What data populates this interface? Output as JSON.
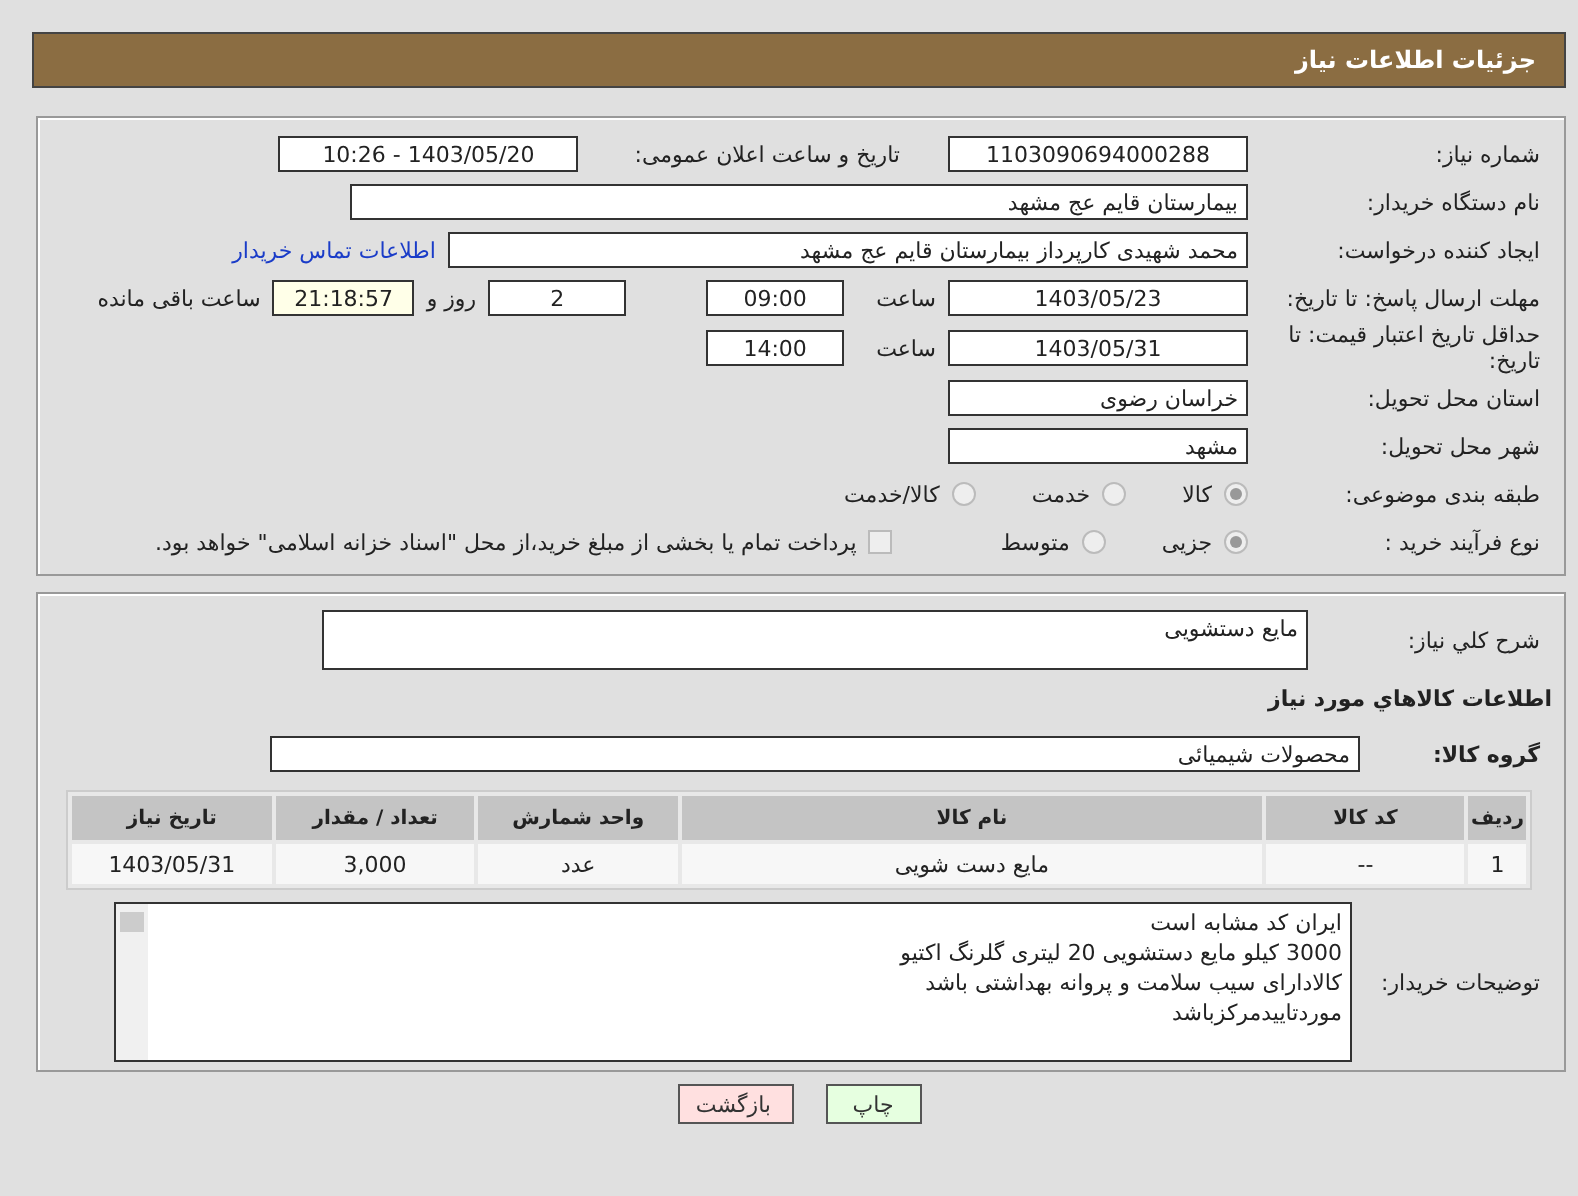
{
  "header": {
    "title": "جزئیات اطلاعات نیاز"
  },
  "need_number": {
    "label": "شماره نیاز:",
    "value": "1103090694000288"
  },
  "announce_date": {
    "label": "تاریخ و ساعت اعلان عمومی:",
    "value": "1403/05/20 - 10:26"
  },
  "buyer_org": {
    "label": "نام دستگاه خریدار:",
    "value": "بیمارستان قایم  عج  مشهد"
  },
  "requester": {
    "label": "ایجاد کننده درخواست:",
    "value": "محمد شهیدی کارپرداز بیمارستان قایم  عج  مشهد",
    "link": "اطلاعات تماس خریدار"
  },
  "reply_deadline": {
    "label": "مهلت ارسال پاسخ: تا تاریخ:",
    "date": "1403/05/23",
    "time_label": "ساعت",
    "time": "09:00",
    "days": "2",
    "days_label": "روز و",
    "remaining": "21:18:57",
    "remaining_label": "ساعت باقی مانده"
  },
  "price_validity": {
    "label": "حداقل تاریخ اعتبار قیمت: تا تاریخ:",
    "date": "1403/05/31",
    "time_label": "ساعت",
    "time": "14:00"
  },
  "province": {
    "label": "استان محل تحویل:",
    "value": "خراسان رضوی"
  },
  "city": {
    "label": "شهر محل تحویل:",
    "value": "مشهد"
  },
  "category": {
    "label": "طبقه بندی موضوعی:",
    "options": [
      {
        "label": "کالا",
        "selected": true
      },
      {
        "label": "خدمت",
        "selected": false
      },
      {
        "label": "کالا/خدمت",
        "selected": false
      }
    ]
  },
  "purchase_type": {
    "label": "نوع فرآیند خرید :",
    "options": [
      {
        "label": "جزیی",
        "selected": true
      },
      {
        "label": "متوسط",
        "selected": false
      }
    ],
    "treasury": {
      "label": "پرداخت تمام یا بخشی از مبلغ خرید،از محل \"اسناد خزانه اسلامی\" خواهد بود.",
      "checked": false
    }
  },
  "description": {
    "label": "شرح کلي نياز:",
    "value": "مایع دستشویی"
  },
  "items_heading": "اطلاعات كالاهاي مورد نياز",
  "goods_group": {
    "label": "گروه کالا:",
    "value": "محصولات شیمیائی"
  },
  "table": {
    "columns": [
      "ردیف",
      "کد کالا",
      "نام کالا",
      "واحد شمارش",
      "تعداد / مقدار",
      "تاریخ نیاز"
    ],
    "rows": [
      [
        "1",
        "--",
        "مایع دست شویی",
        "عدد",
        "3,000",
        "1403/05/31"
      ]
    ]
  },
  "buyer_notes": {
    "label": "توضیحات خریدار:",
    "lines": [
      "ایران کد مشابه است",
      "3000 کیلو  مایع دستشویی 20 لیتری گلرنگ اکتیو",
      "کالادارای  سیب سلامت و پروانه بهداشتی باشد",
      "موردتاییدمرکزباشد"
    ]
  },
  "buttons": [
    {
      "label": "چاپ",
      "kind": "print"
    },
    {
      "label": "بازگشت",
      "kind": "back"
    }
  ]
}
